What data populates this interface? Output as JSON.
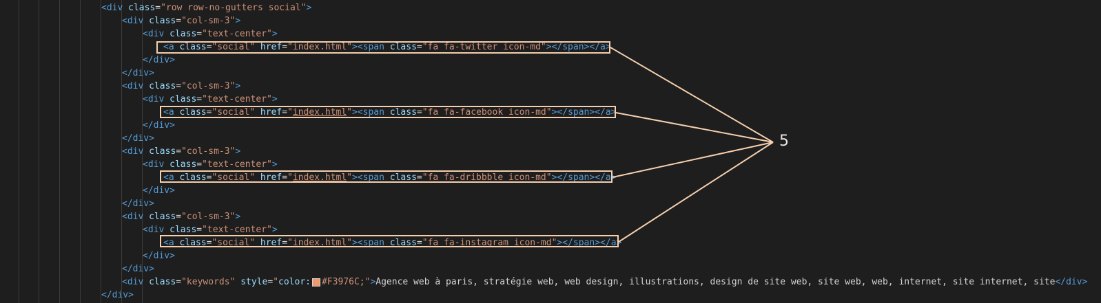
{
  "editor": {
    "lines": [
      {
        "indent": 0,
        "tokens": [
          [
            "tg",
            "<div "
          ],
          [
            "at",
            "class"
          ],
          [
            "tx",
            "="
          ],
          [
            "st",
            "\"row row-no-gutters social\""
          ],
          [
            "tg",
            ">"
          ]
        ]
      },
      {
        "indent": 1,
        "tokens": [
          [
            "tg",
            "<div "
          ],
          [
            "at",
            "class"
          ],
          [
            "tx",
            "="
          ],
          [
            "st",
            "\"col-sm-3\""
          ],
          [
            "tg",
            ">"
          ]
        ]
      },
      {
        "indent": 2,
        "tokens": [
          [
            "tg",
            "<div "
          ],
          [
            "at",
            "class"
          ],
          [
            "tx",
            "="
          ],
          [
            "st",
            "\"text-center\""
          ],
          [
            "tg",
            ">"
          ]
        ]
      },
      {
        "indent": 3,
        "tokens": [
          [
            "tg",
            "<a "
          ],
          [
            "at",
            "class"
          ],
          [
            "tx",
            "="
          ],
          [
            "st",
            "\"social\""
          ],
          [
            "tx",
            " "
          ],
          [
            "at",
            "href"
          ],
          [
            "tx",
            "="
          ],
          [
            "st",
            "\"index.html\""
          ],
          [
            "tg",
            "><span "
          ],
          [
            "at",
            "class"
          ],
          [
            "tx",
            "="
          ],
          [
            "st",
            "\"fa fa-twitter icon-md\""
          ],
          [
            "tg",
            "></span></a>"
          ]
        ]
      },
      {
        "indent": 2,
        "tokens": [
          [
            "tg",
            "</div>"
          ]
        ]
      },
      {
        "indent": 1,
        "tokens": [
          [
            "tg",
            "</div>"
          ]
        ]
      },
      {
        "indent": 1,
        "tokens": [
          [
            "tg",
            "<div "
          ],
          [
            "at",
            "class"
          ],
          [
            "tx",
            "="
          ],
          [
            "st",
            "\"col-sm-3\""
          ],
          [
            "tg",
            ">"
          ]
        ]
      },
      {
        "indent": 2,
        "tokens": [
          [
            "tg",
            "<div "
          ],
          [
            "at",
            "class"
          ],
          [
            "tx",
            "="
          ],
          [
            "st",
            "\"text-center\""
          ],
          [
            "tg",
            ">"
          ]
        ]
      },
      {
        "indent": 3,
        "tokens": [
          [
            "tg",
            "<a "
          ],
          [
            "at",
            "class"
          ],
          [
            "tx",
            "="
          ],
          [
            "st",
            "\"social\""
          ],
          [
            "tx",
            " "
          ],
          [
            "at",
            "href"
          ],
          [
            "tx",
            "="
          ],
          [
            "st",
            "\""
          ],
          [
            "stu",
            "index.html"
          ],
          [
            "st",
            "\""
          ],
          [
            "tg",
            "><span "
          ],
          [
            "at",
            "class"
          ],
          [
            "tx",
            "="
          ],
          [
            "st",
            "\"fa fa-facebook icon-md\""
          ],
          [
            "tg",
            "></span></a>"
          ]
        ]
      },
      {
        "indent": 2,
        "tokens": [
          [
            "tg",
            "</div>"
          ]
        ]
      },
      {
        "indent": 1,
        "tokens": [
          [
            "tg",
            "</div>"
          ]
        ]
      },
      {
        "indent": 1,
        "tokens": [
          [
            "tg",
            "<div "
          ],
          [
            "at",
            "class"
          ],
          [
            "tx",
            "="
          ],
          [
            "st",
            "\"col-sm-3\""
          ],
          [
            "tg",
            ">"
          ]
        ]
      },
      {
        "indent": 2,
        "tokens": [
          [
            "tg",
            "<div "
          ],
          [
            "at",
            "class"
          ],
          [
            "tx",
            "="
          ],
          [
            "st",
            "\"text-center\""
          ],
          [
            "tg",
            ">"
          ]
        ]
      },
      {
        "indent": 3,
        "tokens": [
          [
            "tg",
            "<a "
          ],
          [
            "at",
            "class"
          ],
          [
            "tx",
            "="
          ],
          [
            "st",
            "\"social\""
          ],
          [
            "tx",
            " "
          ],
          [
            "at",
            "href"
          ],
          [
            "tx",
            "="
          ],
          [
            "st",
            "\""
          ],
          [
            "stu",
            "index.html"
          ],
          [
            "st",
            "\""
          ],
          [
            "tg",
            "><span "
          ],
          [
            "at",
            "class"
          ],
          [
            "tx",
            "="
          ],
          [
            "st",
            "\"fa fa-dribbble icon-md\""
          ],
          [
            "tg",
            "></span></a>"
          ]
        ]
      },
      {
        "indent": 2,
        "tokens": [
          [
            "tg",
            "</div>"
          ]
        ]
      },
      {
        "indent": 1,
        "tokens": [
          [
            "tg",
            "</div>"
          ]
        ]
      },
      {
        "indent": 1,
        "tokens": [
          [
            "tg",
            "<div "
          ],
          [
            "at",
            "class"
          ],
          [
            "tx",
            "="
          ],
          [
            "st",
            "\"col-sm-3\""
          ],
          [
            "tg",
            ">"
          ]
        ]
      },
      {
        "indent": 2,
        "tokens": [
          [
            "tg",
            "<div "
          ],
          [
            "at",
            "class"
          ],
          [
            "tx",
            "="
          ],
          [
            "st",
            "\"text-center\""
          ],
          [
            "tg",
            ">"
          ]
        ]
      },
      {
        "indent": 3,
        "tokens": [
          [
            "tg",
            "<a "
          ],
          [
            "at",
            "class"
          ],
          [
            "tx",
            "="
          ],
          [
            "st",
            "\"social\""
          ],
          [
            "tx",
            " "
          ],
          [
            "at",
            "href"
          ],
          [
            "tx",
            "="
          ],
          [
            "st",
            "\""
          ],
          [
            "stu",
            "index.html"
          ],
          [
            "st",
            "\""
          ],
          [
            "tg",
            "><span "
          ],
          [
            "at",
            "class"
          ],
          [
            "tx",
            "="
          ],
          [
            "st",
            "\"fa fa-instagram icon-md\""
          ],
          [
            "tg",
            "></span></a>"
          ]
        ]
      },
      {
        "indent": 2,
        "tokens": [
          [
            "tg",
            "</div>"
          ]
        ]
      },
      {
        "indent": 1,
        "tokens": [
          [
            "tg",
            "</div>"
          ]
        ]
      },
      {
        "indent": 1,
        "tokens": [
          [
            "tg",
            "<div "
          ],
          [
            "at",
            "class"
          ],
          [
            "tx",
            "="
          ],
          [
            "st",
            "\"keywords\""
          ],
          [
            "tx",
            " "
          ],
          [
            "at",
            "style"
          ],
          [
            "tx",
            "="
          ],
          [
            "st",
            "\""
          ],
          [
            "at",
            "color:"
          ],
          [
            "sw",
            ""
          ],
          [
            "st",
            "#F3976C;\""
          ],
          [
            "tg",
            ">"
          ],
          [
            "tx",
            "Agence web à paris, stratégie web, web design, illustrations, design de site web, site web, web, internet, site internet, site"
          ],
          [
            "tg",
            "</div>"
          ]
        ]
      },
      {
        "indent": 0,
        "tokens": [
          [
            "tg",
            "</div>"
          ]
        ]
      }
    ],
    "swatch_color": "#F3976C"
  },
  "annotation": {
    "label": "5",
    "color": "#f5cfae"
  }
}
